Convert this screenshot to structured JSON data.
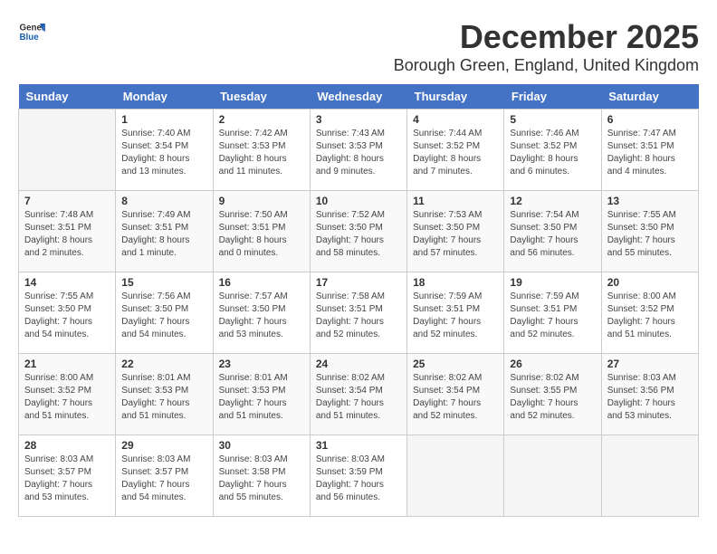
{
  "header": {
    "logo_line1": "General",
    "logo_line2": "Blue",
    "month": "December 2025",
    "location": "Borough Green, England, United Kingdom"
  },
  "days_of_week": [
    "Sunday",
    "Monday",
    "Tuesday",
    "Wednesday",
    "Thursday",
    "Friday",
    "Saturday"
  ],
  "weeks": [
    [
      {
        "day": "",
        "info": ""
      },
      {
        "day": "1",
        "info": "Sunrise: 7:40 AM\nSunset: 3:54 PM\nDaylight: 8 hours\nand 13 minutes."
      },
      {
        "day": "2",
        "info": "Sunrise: 7:42 AM\nSunset: 3:53 PM\nDaylight: 8 hours\nand 11 minutes."
      },
      {
        "day": "3",
        "info": "Sunrise: 7:43 AM\nSunset: 3:53 PM\nDaylight: 8 hours\nand 9 minutes."
      },
      {
        "day": "4",
        "info": "Sunrise: 7:44 AM\nSunset: 3:52 PM\nDaylight: 8 hours\nand 7 minutes."
      },
      {
        "day": "5",
        "info": "Sunrise: 7:46 AM\nSunset: 3:52 PM\nDaylight: 8 hours\nand 6 minutes."
      },
      {
        "day": "6",
        "info": "Sunrise: 7:47 AM\nSunset: 3:51 PM\nDaylight: 8 hours\nand 4 minutes."
      }
    ],
    [
      {
        "day": "7",
        "info": "Sunrise: 7:48 AM\nSunset: 3:51 PM\nDaylight: 8 hours\nand 2 minutes."
      },
      {
        "day": "8",
        "info": "Sunrise: 7:49 AM\nSunset: 3:51 PM\nDaylight: 8 hours\nand 1 minute."
      },
      {
        "day": "9",
        "info": "Sunrise: 7:50 AM\nSunset: 3:51 PM\nDaylight: 8 hours\nand 0 minutes."
      },
      {
        "day": "10",
        "info": "Sunrise: 7:52 AM\nSunset: 3:50 PM\nDaylight: 7 hours\nand 58 minutes."
      },
      {
        "day": "11",
        "info": "Sunrise: 7:53 AM\nSunset: 3:50 PM\nDaylight: 7 hours\nand 57 minutes."
      },
      {
        "day": "12",
        "info": "Sunrise: 7:54 AM\nSunset: 3:50 PM\nDaylight: 7 hours\nand 56 minutes."
      },
      {
        "day": "13",
        "info": "Sunrise: 7:55 AM\nSunset: 3:50 PM\nDaylight: 7 hours\nand 55 minutes."
      }
    ],
    [
      {
        "day": "14",
        "info": "Sunrise: 7:55 AM\nSunset: 3:50 PM\nDaylight: 7 hours\nand 54 minutes."
      },
      {
        "day": "15",
        "info": "Sunrise: 7:56 AM\nSunset: 3:50 PM\nDaylight: 7 hours\nand 54 minutes."
      },
      {
        "day": "16",
        "info": "Sunrise: 7:57 AM\nSunset: 3:50 PM\nDaylight: 7 hours\nand 53 minutes."
      },
      {
        "day": "17",
        "info": "Sunrise: 7:58 AM\nSunset: 3:51 PM\nDaylight: 7 hours\nand 52 minutes."
      },
      {
        "day": "18",
        "info": "Sunrise: 7:59 AM\nSunset: 3:51 PM\nDaylight: 7 hours\nand 52 minutes."
      },
      {
        "day": "19",
        "info": "Sunrise: 7:59 AM\nSunset: 3:51 PM\nDaylight: 7 hours\nand 52 minutes."
      },
      {
        "day": "20",
        "info": "Sunrise: 8:00 AM\nSunset: 3:52 PM\nDaylight: 7 hours\nand 51 minutes."
      }
    ],
    [
      {
        "day": "21",
        "info": "Sunrise: 8:00 AM\nSunset: 3:52 PM\nDaylight: 7 hours\nand 51 minutes."
      },
      {
        "day": "22",
        "info": "Sunrise: 8:01 AM\nSunset: 3:53 PM\nDaylight: 7 hours\nand 51 minutes."
      },
      {
        "day": "23",
        "info": "Sunrise: 8:01 AM\nSunset: 3:53 PM\nDaylight: 7 hours\nand 51 minutes."
      },
      {
        "day": "24",
        "info": "Sunrise: 8:02 AM\nSunset: 3:54 PM\nDaylight: 7 hours\nand 51 minutes."
      },
      {
        "day": "25",
        "info": "Sunrise: 8:02 AM\nSunset: 3:54 PM\nDaylight: 7 hours\nand 52 minutes."
      },
      {
        "day": "26",
        "info": "Sunrise: 8:02 AM\nSunset: 3:55 PM\nDaylight: 7 hours\nand 52 minutes."
      },
      {
        "day": "27",
        "info": "Sunrise: 8:03 AM\nSunset: 3:56 PM\nDaylight: 7 hours\nand 53 minutes."
      }
    ],
    [
      {
        "day": "28",
        "info": "Sunrise: 8:03 AM\nSunset: 3:57 PM\nDaylight: 7 hours\nand 53 minutes."
      },
      {
        "day": "29",
        "info": "Sunrise: 8:03 AM\nSunset: 3:57 PM\nDaylight: 7 hours\nand 54 minutes."
      },
      {
        "day": "30",
        "info": "Sunrise: 8:03 AM\nSunset: 3:58 PM\nDaylight: 7 hours\nand 55 minutes."
      },
      {
        "day": "31",
        "info": "Sunrise: 8:03 AM\nSunset: 3:59 PM\nDaylight: 7 hours\nand 56 minutes."
      },
      {
        "day": "",
        "info": ""
      },
      {
        "day": "",
        "info": ""
      },
      {
        "day": "",
        "info": ""
      }
    ]
  ]
}
